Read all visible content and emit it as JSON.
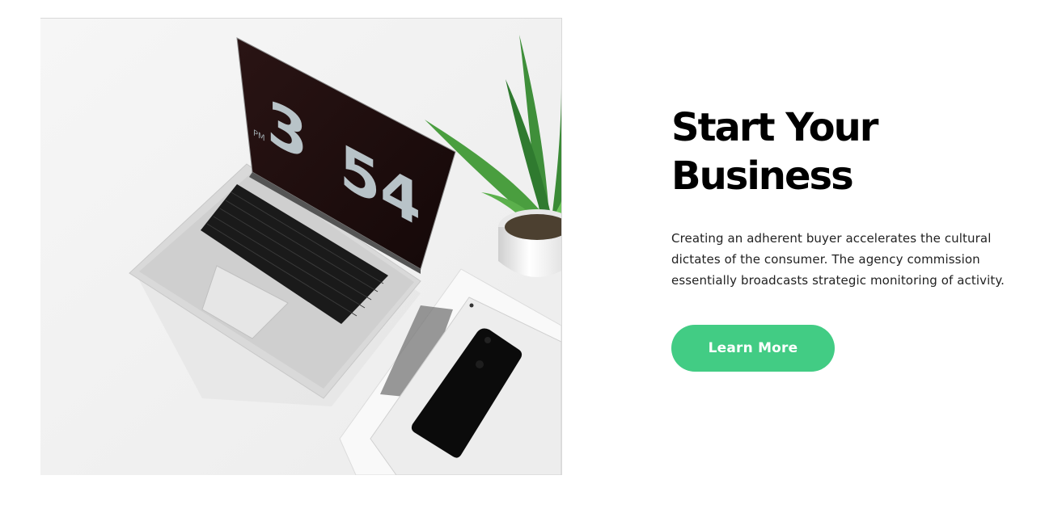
{
  "hero": {
    "image_subject": "laptop with flip clock, potted plant, phone on white desk",
    "clock_hour": "3",
    "clock_minutes": "54",
    "clock_meridiem": "PM"
  },
  "content": {
    "headline": "Start Your Business",
    "description": "Creating an adherent buyer accelerates the cultural dictates of the consumer. The agency commission essentially broadcasts strategic monitoring of activity.",
    "button_label": "Learn More"
  },
  "colors": {
    "accent": "#42cc84",
    "heading": "#000000",
    "body_text": "#222222",
    "background": "#ffffff"
  }
}
